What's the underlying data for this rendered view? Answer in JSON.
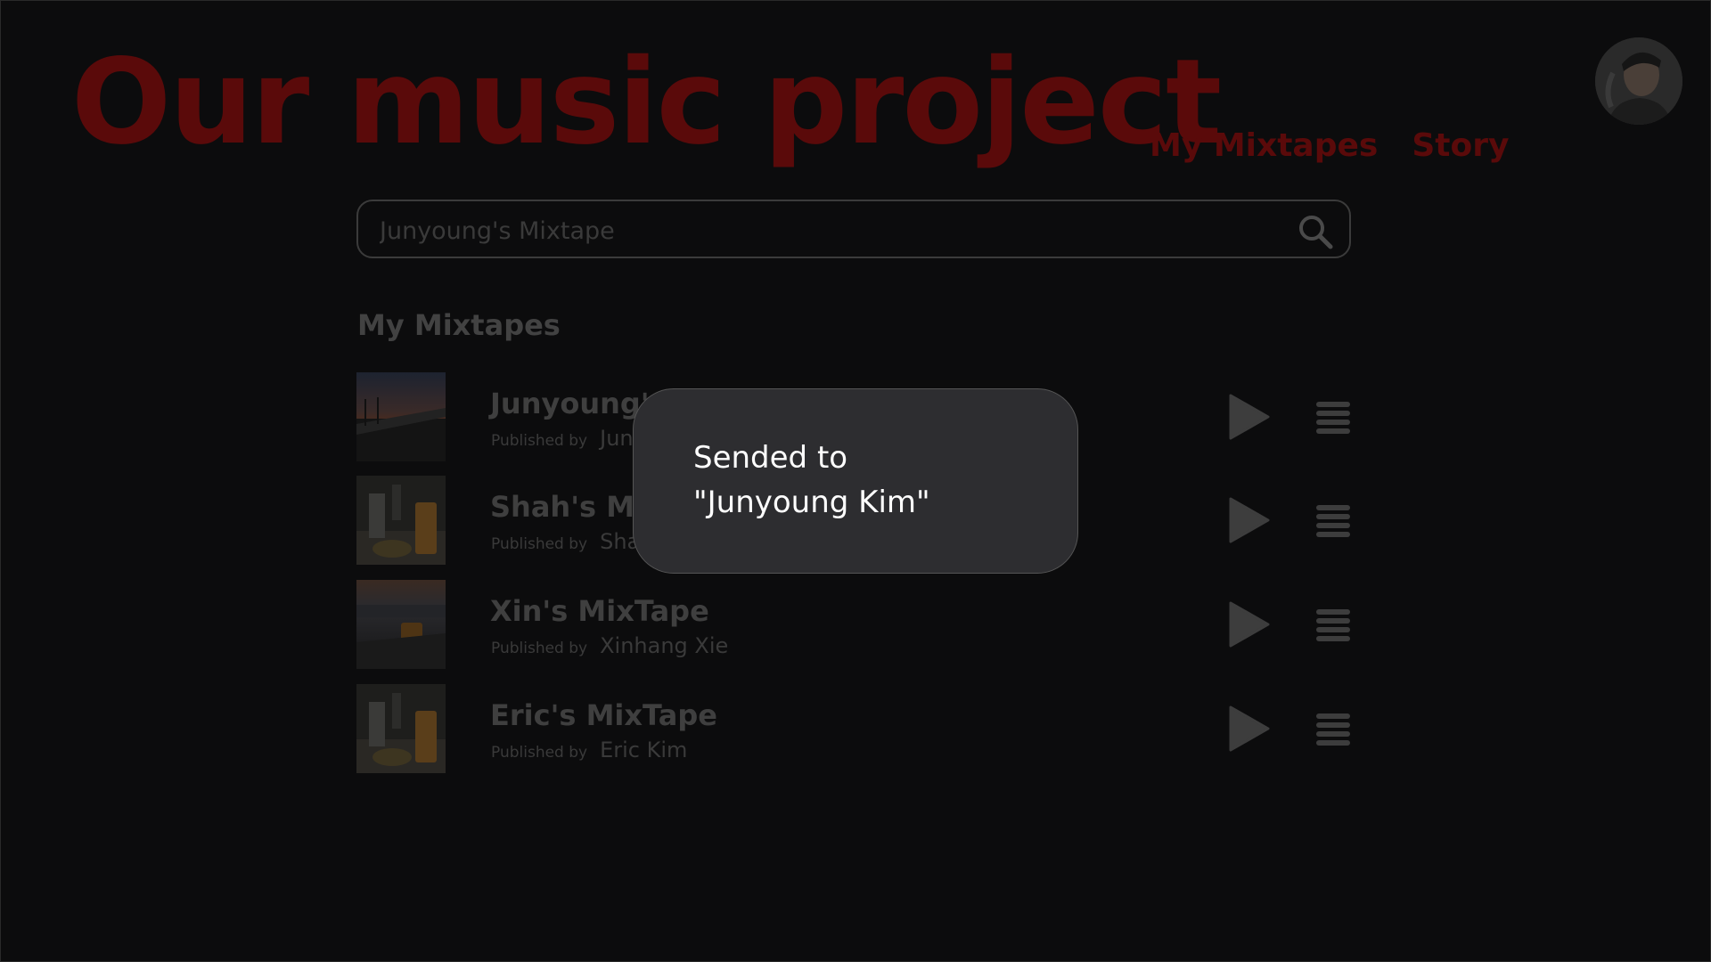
{
  "header": {
    "title": "Our music project",
    "nav": [
      "My Mixtapes",
      "Story"
    ]
  },
  "search": {
    "placeholder": "Junyoung's Mixtape",
    "icon": "search-icon"
  },
  "section": {
    "title": "My Mixtapes"
  },
  "mixtapes": [
    {
      "title": "Junyoung's MixTape",
      "published_label": "Published by",
      "author": "Junyoung Kim",
      "thumb": "sunset-harbor"
    },
    {
      "title": "Shah's MixTape",
      "published_label": "Published by",
      "author": "Shah",
      "thumb": "drinks-table"
    },
    {
      "title": "Xin's MixTape",
      "published_label": "Published by",
      "author": "Xinhang Xie",
      "thumb": "harbor-drinks"
    },
    {
      "title": "Eric's MixTape",
      "published_label": "Published by",
      "author": "Eric Kim",
      "thumb": "drinks-table"
    }
  ],
  "toast": {
    "message_line1": "Sended to",
    "message_line2": "\"Junyoung Kim\""
  },
  "colors": {
    "background": "#0c0c0d",
    "title_dim_red": "#5a0a0a",
    "toast_bg": "#2d2d30",
    "toast_text": "#ffffff"
  }
}
